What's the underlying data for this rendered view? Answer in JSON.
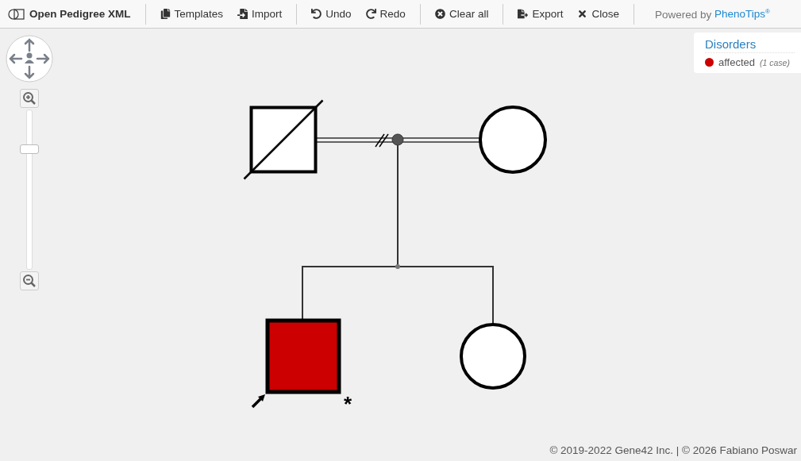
{
  "toolbar": {
    "groups": [
      [
        {
          "label": "Open Pedigree XML"
        }
      ],
      [
        {
          "label": "Templates"
        },
        {
          "label": "Import"
        }
      ],
      [
        {
          "label": "Undo"
        },
        {
          "label": "Redo"
        }
      ],
      [
        {
          "label": "Clear all"
        }
      ],
      [
        {
          "label": "Export"
        },
        {
          "label": "Close"
        }
      ]
    ],
    "powered": {
      "prefix": "Powered by",
      "brand": "PhenoTips$^{®}$"
    }
  },
  "zoom": {
    "level": 0.77
  },
  "legend": {
    "title": "Disorders",
    "items": [
      {
        "label": "affected",
        "count": "(1 case)",
        "color": "#cc0000"
      }
    ]
  },
  "pedigree": {
    "nodes": [
      {
        "kind": "square",
        "deceased": true,
        "affected": false,
        "proband": false
      },
      {
        "kind": "circle",
        "deceased": false,
        "affected": false,
        "proband": false
      },
      {
        "kind": "square",
        "deceased": false,
        "affected": true,
        "proband": true,
        "mark": "*"
      },
      {
        "kind": "circle",
        "deceased": false,
        "affected": false,
        "proband": false
      }
    ],
    "partnership": {
      "separated": true
    }
  },
  "footer": "© 2019-2022 Gene42 Inc. | © 2026 Fabiano Poswar"
}
